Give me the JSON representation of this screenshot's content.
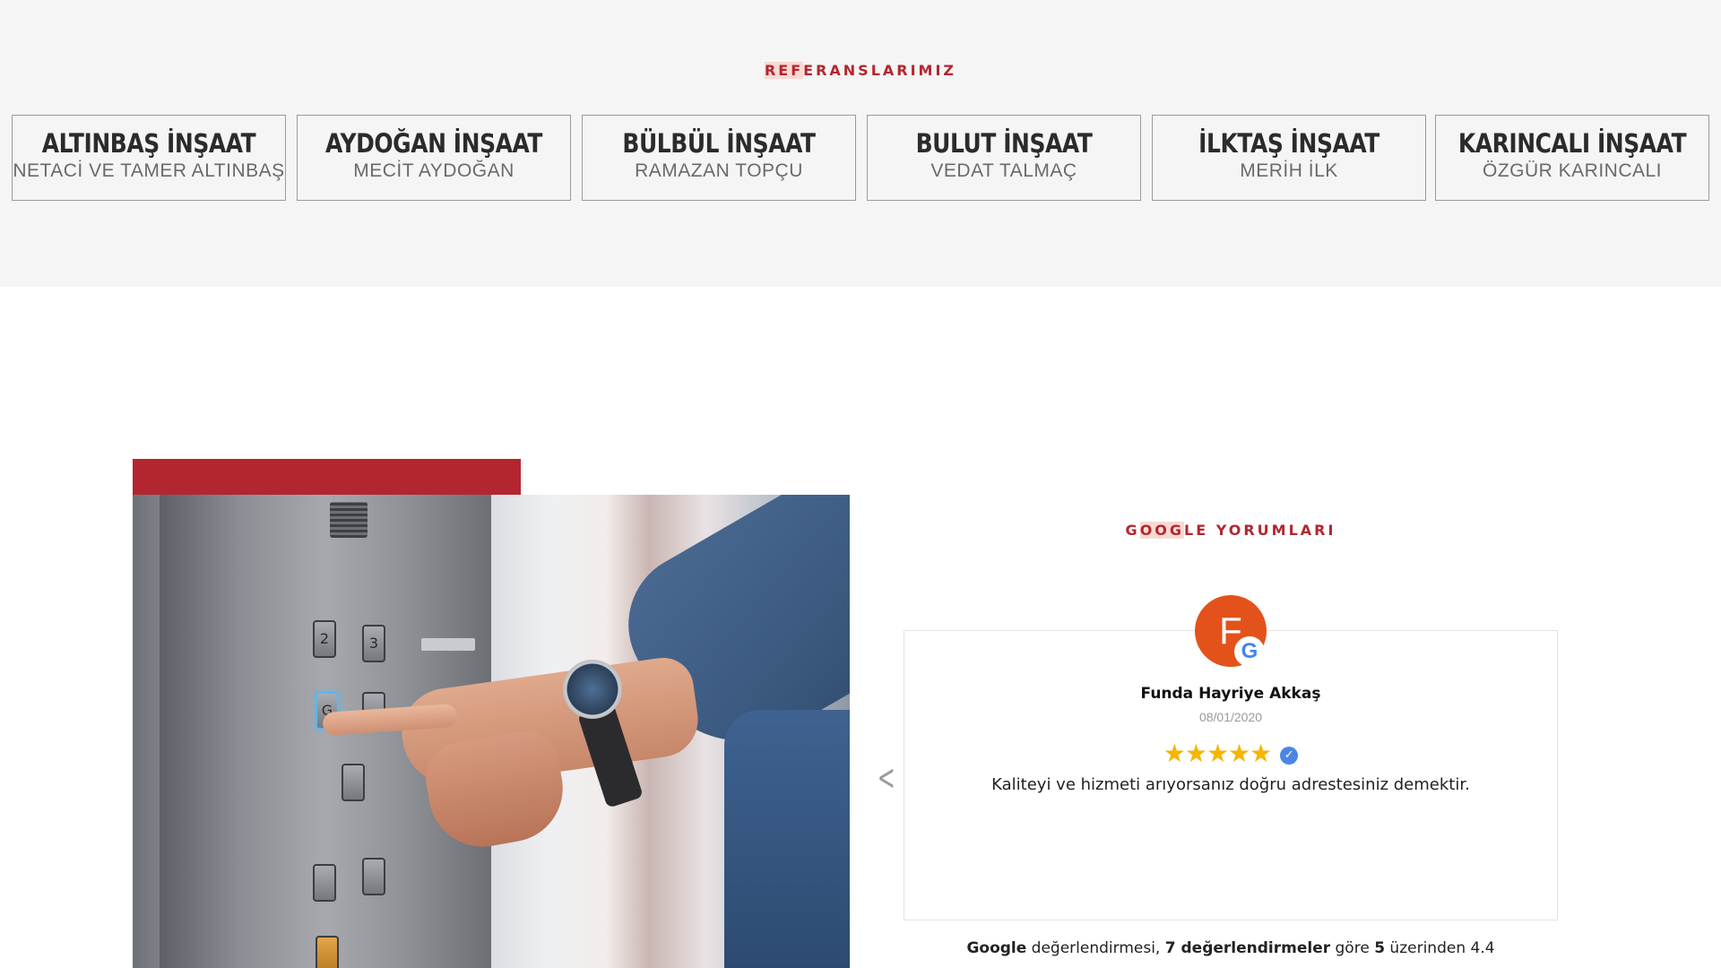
{
  "references": {
    "title_highlight": "REF",
    "title_rest": "ERANSLARIMIZ",
    "items": [
      {
        "company": "ALTINBAŞ İNŞAAT",
        "person": "NETACİ VE TAMER ALTINBAŞ"
      },
      {
        "company": "AYDOĞAN İNŞAAT",
        "person": "MECİT AYDOĞAN"
      },
      {
        "company": "BÜLBÜL İNŞAAT",
        "person": "RAMAZAN TOPÇU"
      },
      {
        "company": "BULUT İNŞAAT",
        "person": "VEDAT TALMAÇ"
      },
      {
        "company": "İLKTAŞ İNŞAAT",
        "person": "MERİH İLK"
      },
      {
        "company": "KARINCALI İNŞAAT",
        "person": "ÖZGÜR KARINCALI"
      }
    ],
    "prev_icon": "chevron-left-icon",
    "next_icon": "chevron-right-icon"
  },
  "photo": {
    "elevator_buttons": [
      "2",
      "3",
      "G",
      "",
      "",
      "",
      "",
      ""
    ]
  },
  "google_reviews": {
    "title_prefix": "G",
    "title_highlight": "OOG",
    "title_rest": "LE YORUMLARI",
    "review": {
      "avatar_initial": "F",
      "badge": "G",
      "name": "Funda Hayriye Akkaş",
      "date": "08/01/2020",
      "stars": "★★★★★",
      "rating": 5,
      "verified_icon": "✓",
      "text": "Kaliteyi ve hizmeti arıyorsanız doğru adrestesiniz demektir."
    },
    "summary": {
      "source": "Google",
      "part1": " değerlendirmesi, ",
      "count": "7 değerlendirmeler",
      "part2": " göre ",
      "max": "5",
      "part3": " üzerinden 4.4"
    },
    "prev_icon": "chevron-left-icon"
  },
  "colors": {
    "accent": "#b3262f",
    "highlight": "#f8d9d4",
    "avatar": "#e4521b",
    "star": "#f5b500",
    "verified": "#4a86e8"
  }
}
